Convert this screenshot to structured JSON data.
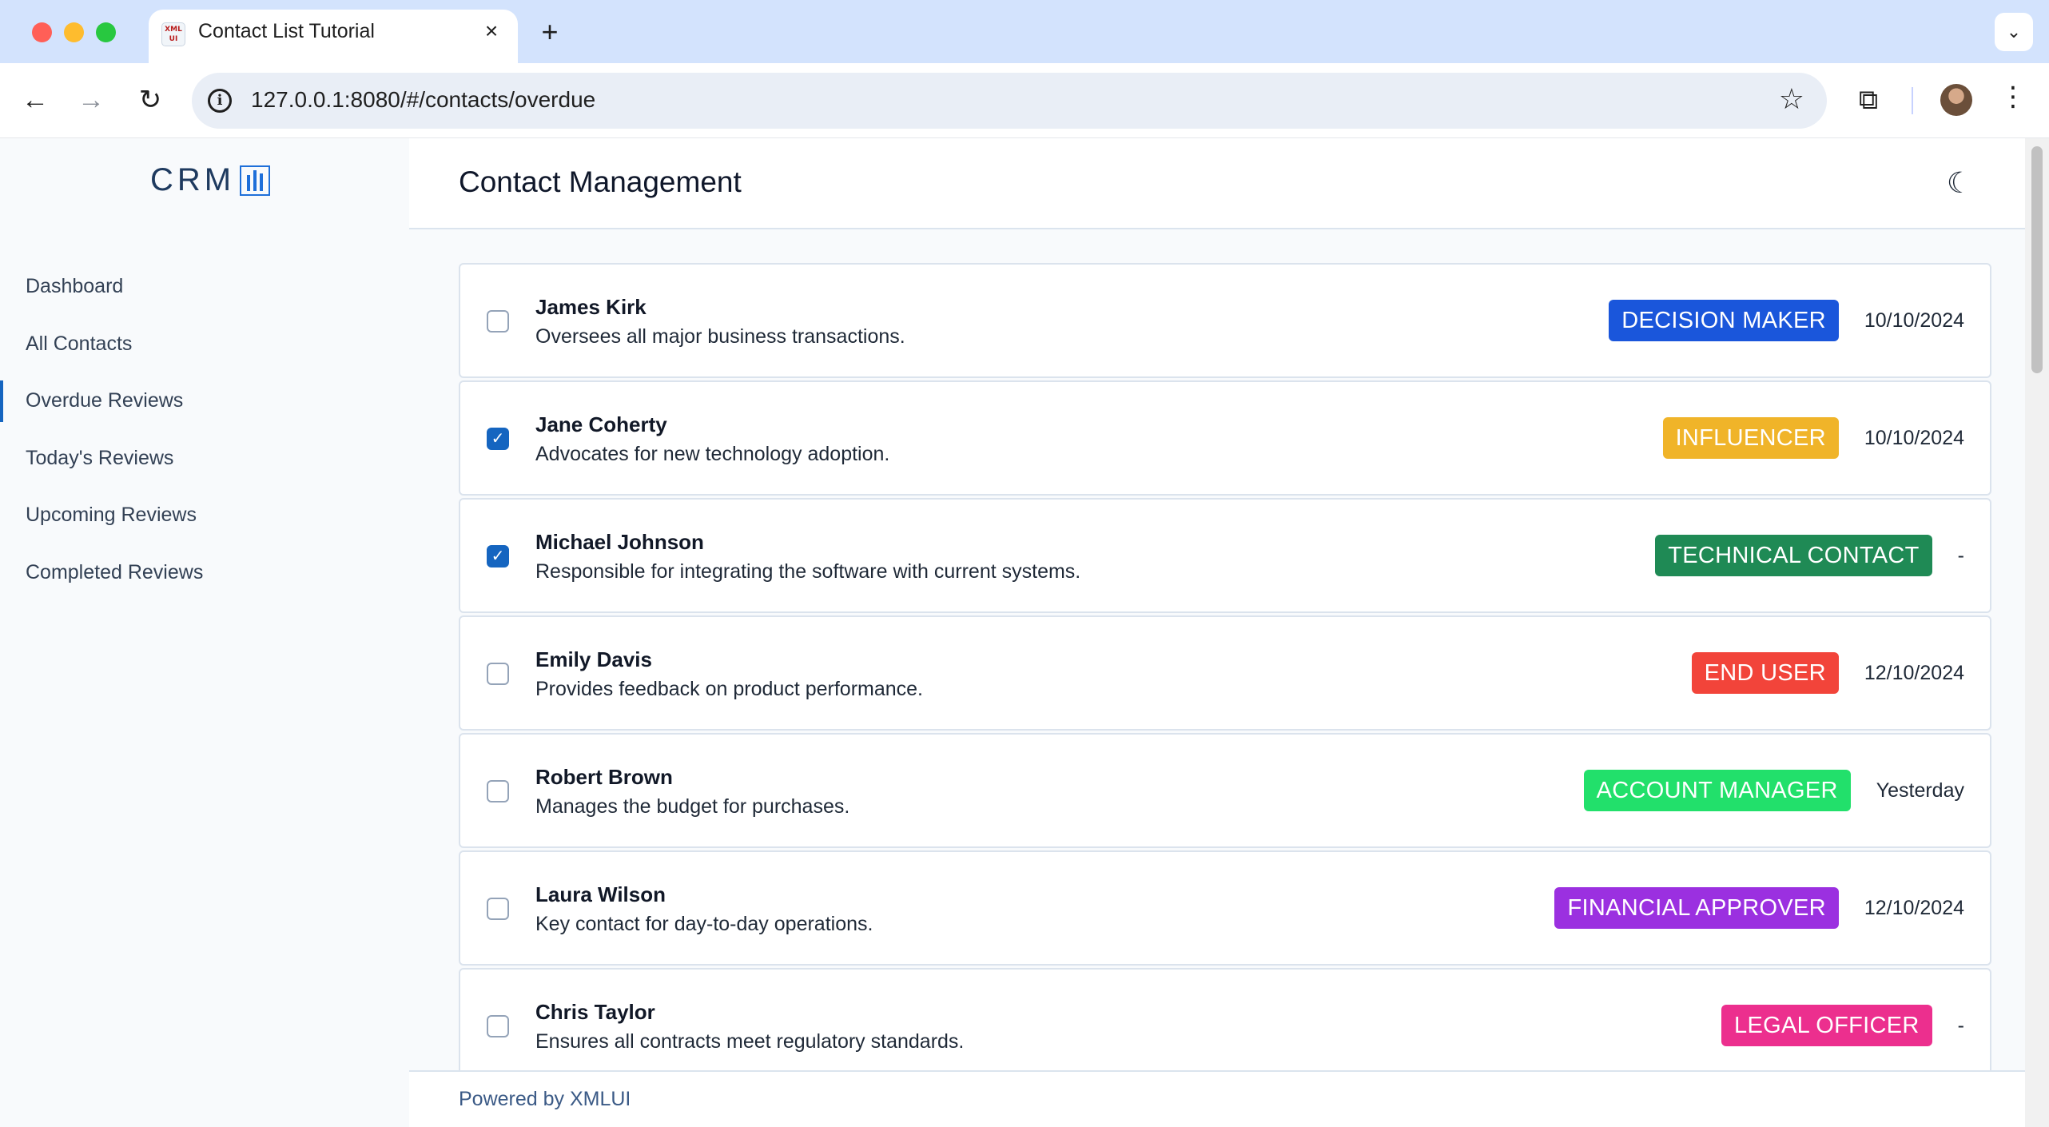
{
  "browser": {
    "tab_title": "Contact List Tutorial",
    "tab_favicon": "XML UI",
    "tab_close": "×",
    "new_tab": "+",
    "tab_menu": "⌄",
    "url": "127.0.0.1:8080/#/contacts/overdue",
    "back": "←",
    "forward": "→",
    "reload": "↻",
    "info": "i",
    "bookmark": "☆",
    "extensions": "⧉",
    "menu": "⋮"
  },
  "logo": {
    "text": "CRM"
  },
  "nav": {
    "items": [
      {
        "label": "Dashboard"
      },
      {
        "label": "All Contacts"
      },
      {
        "label": "Overdue Reviews"
      },
      {
        "label": "Today's Reviews"
      },
      {
        "label": "Upcoming Reviews"
      },
      {
        "label": "Completed Reviews"
      }
    ],
    "active_index": 2
  },
  "header": {
    "title": "Contact Management",
    "theme_toggle": "☾"
  },
  "contacts": [
    {
      "name": "James Kirk",
      "description": "Oversees all major business transactions.",
      "role": "DECISION MAKER",
      "role_color": "#1a56db",
      "date": "10/10/2024",
      "checked": false
    },
    {
      "name": "Jane Coherty",
      "description": "Advocates for new technology adoption.",
      "role": "INFLUENCER",
      "role_color": "#f0b429",
      "date": "10/10/2024",
      "checked": true
    },
    {
      "name": "Michael Johnson",
      "description": "Responsible for integrating the software with current systems.",
      "role": "TECHNICAL CONTACT",
      "role_color": "#1f8a55",
      "date": "-",
      "checked": true
    },
    {
      "name": "Emily Davis",
      "description": "Provides feedback on product performance.",
      "role": "END USER",
      "role_color": "#f2443a",
      "date": "12/10/2024",
      "checked": false
    },
    {
      "name": "Robert Brown",
      "description": "Manages the budget for purchases.",
      "role": "ACCOUNT MANAGER",
      "role_color": "#22e06b",
      "date": "Yesterday",
      "checked": false
    },
    {
      "name": "Laura Wilson",
      "description": "Key contact for day-to-day operations.",
      "role": "FINANCIAL APPROVER",
      "role_color": "#9b30e0",
      "date": "12/10/2024",
      "checked": false
    },
    {
      "name": "Chris Taylor",
      "description": "Ensures all contracts meet regulatory standards.",
      "role": "LEGAL OFFICER",
      "role_color": "#ec2f8e",
      "date": "-",
      "checked": false
    }
  ],
  "footer": {
    "text": "Powered by XMLUI"
  },
  "colors": {
    "accent": "#1565c0",
    "sidebar_bg": "#f8fafc",
    "tabstrip_bg": "#d3e3fd"
  }
}
